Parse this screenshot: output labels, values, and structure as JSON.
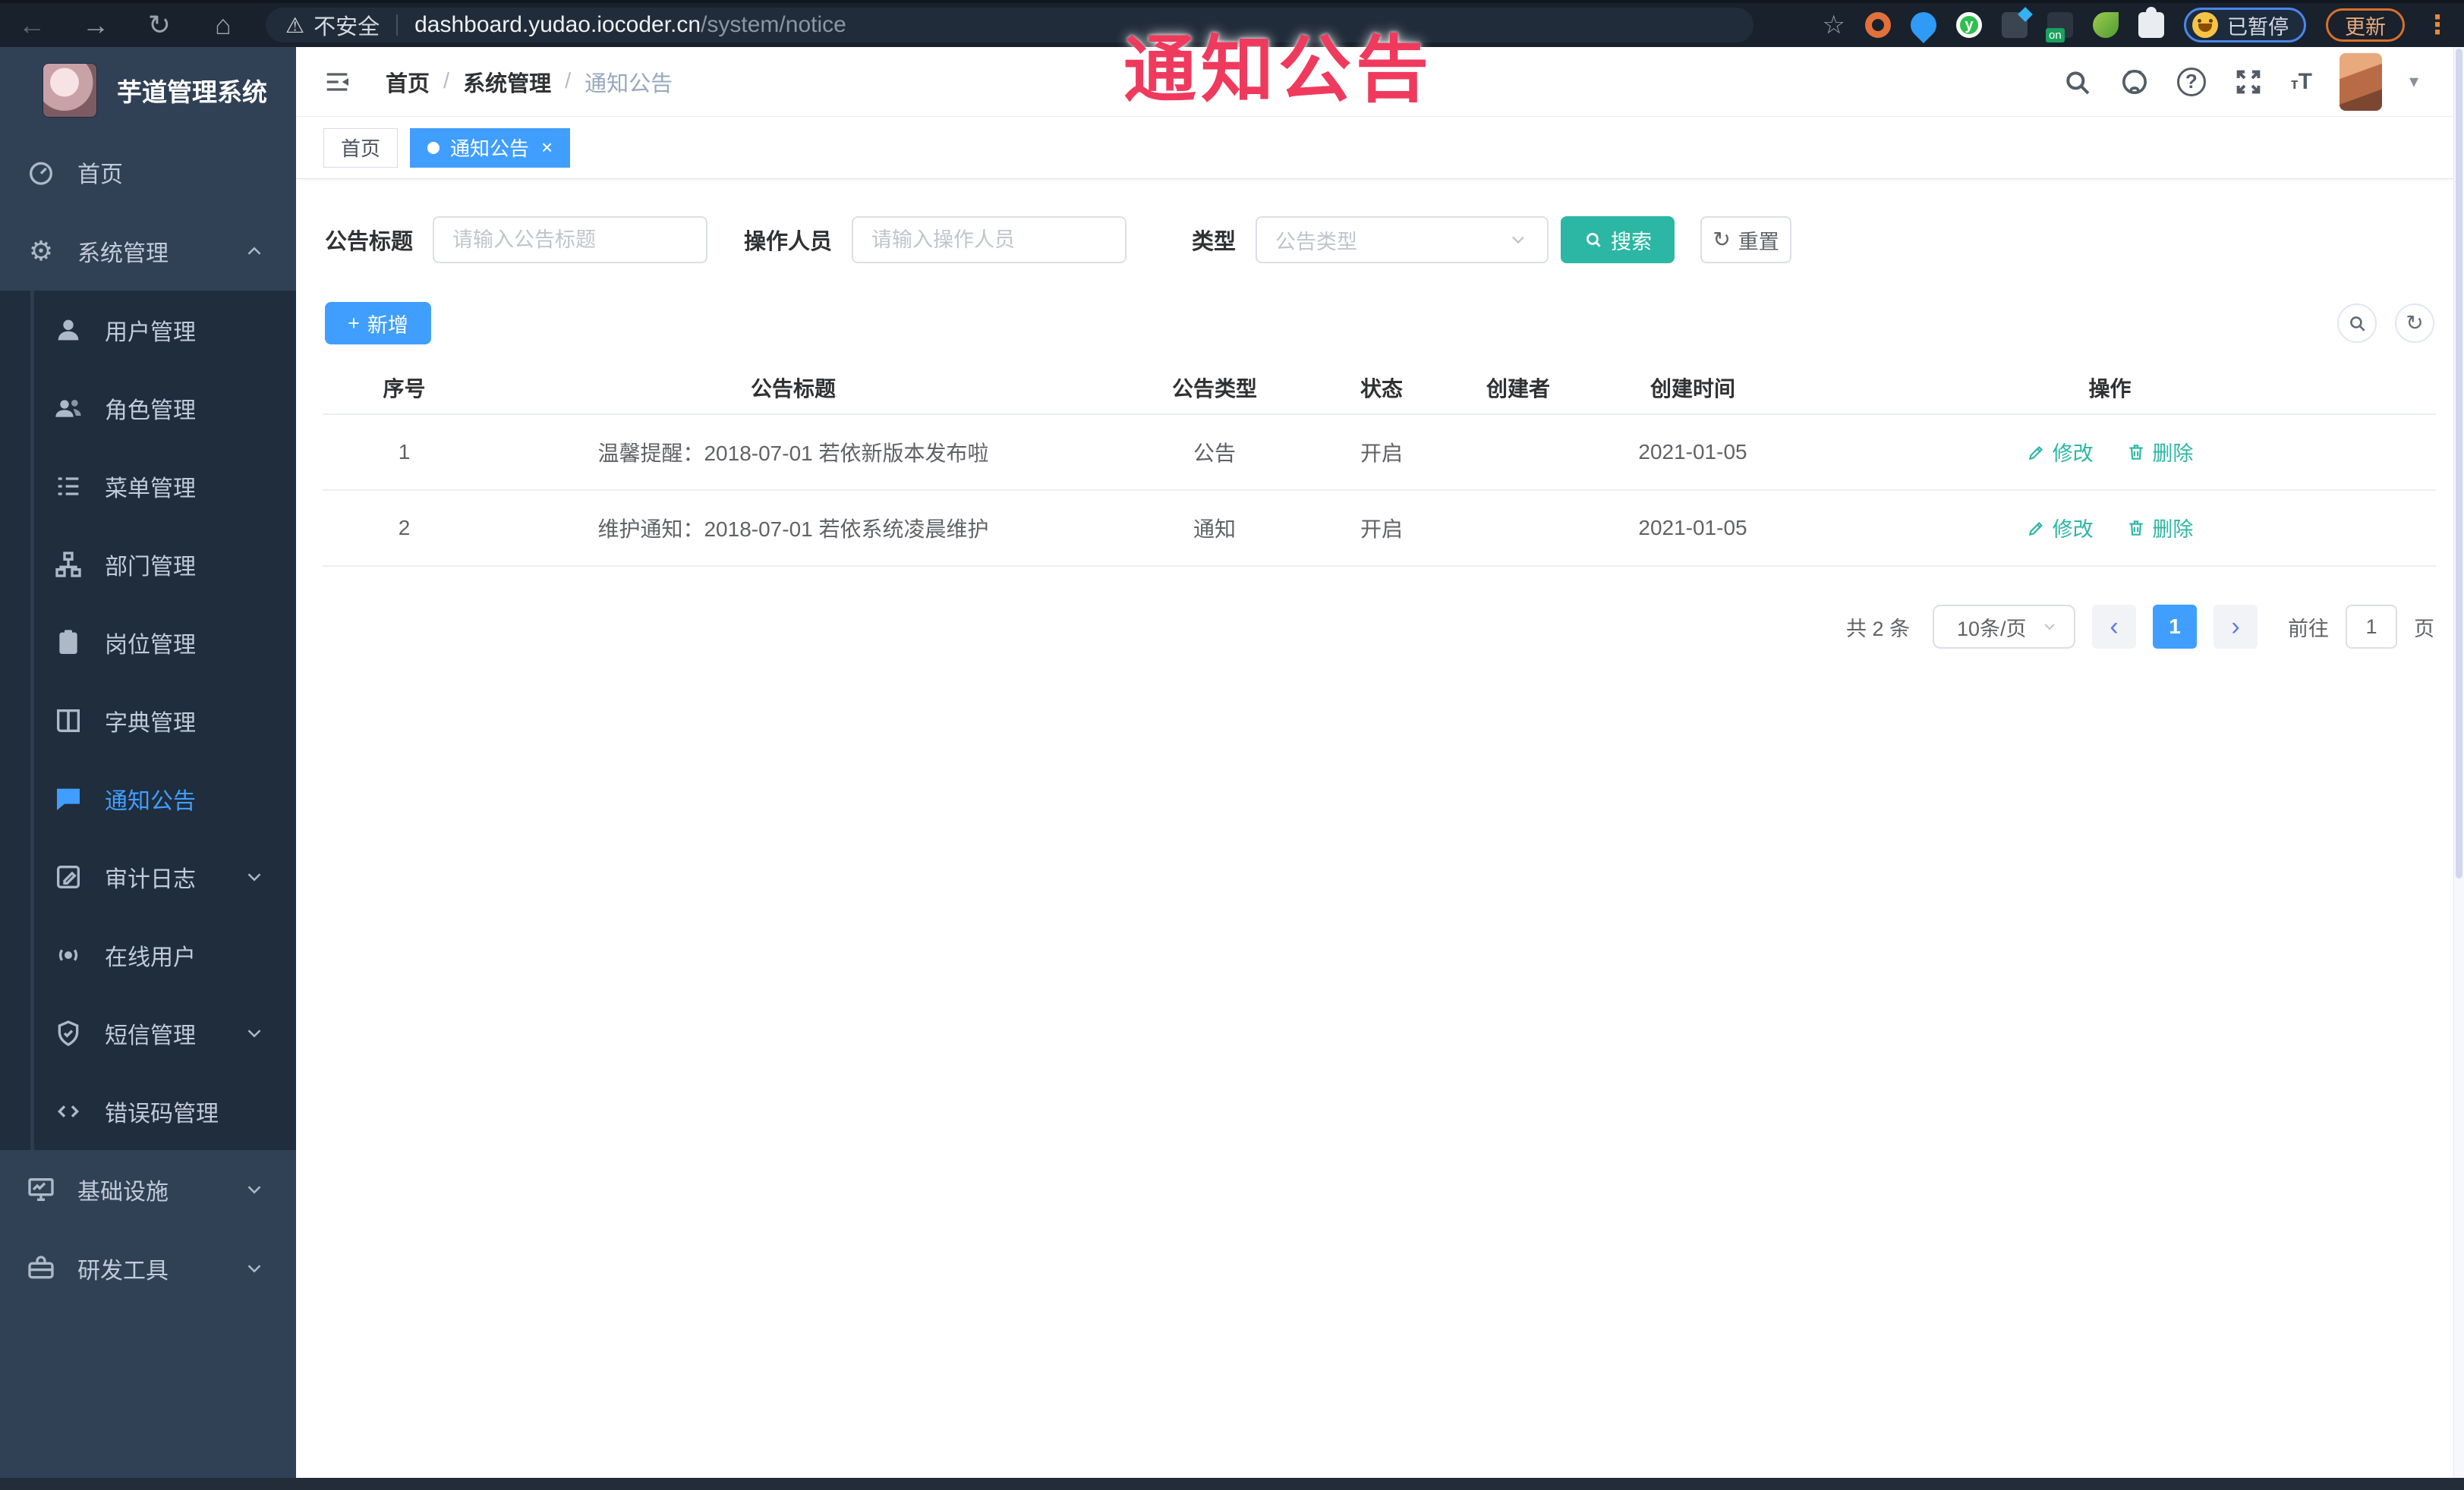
{
  "browser": {
    "security_label": "不安全",
    "url_host": "dashboard.yudao.iocoder.cn",
    "url_path": "/system/notice",
    "profile_status": "已暂停",
    "update_label": "更新"
  },
  "icons": {
    "back": "←",
    "forward": "→",
    "reload": "↻",
    "home": "⌂",
    "star": "☆",
    "warning": "⚠",
    "gear": "⚙",
    "plus": "+",
    "close": "×",
    "prev": "‹",
    "next": "›",
    "question": "?",
    "refresh": "↻",
    "caret_down": "▾",
    "kebab": "⋮",
    "font_small": "т",
    "font_large": "T"
  },
  "overlay": {
    "title": "通知公告"
  },
  "sidebar": {
    "logo_title": "芋道管理系统",
    "items": [
      {
        "label": "首页"
      },
      {
        "label": "系统管理",
        "expanded": true,
        "children": [
          "用户管理",
          "角色管理",
          "菜单管理",
          "部门管理",
          "岗位管理",
          "字典管理",
          "通知公告",
          "审计日志",
          "在线用户",
          "短信管理",
          "错误码管理"
        ]
      },
      {
        "label": "基础设施"
      },
      {
        "label": "研发工具"
      }
    ],
    "active_item": "通知公告"
  },
  "breadcrumb": {
    "items": [
      "首页",
      "系统管理",
      "通知公告"
    ],
    "separator": "/"
  },
  "tabs": [
    {
      "label": "首页",
      "active": false
    },
    {
      "label": "通知公告",
      "active": true
    }
  ],
  "filters": {
    "title_label": "公告标题",
    "title_placeholder": "请输入公告标题",
    "operator_label": "操作人员",
    "operator_placeholder": "请输入操作人员",
    "type_label": "类型",
    "type_placeholder": "公告类型",
    "search_label": "搜索",
    "reset_label": "重置"
  },
  "toolbar": {
    "add_label": "新增"
  },
  "table": {
    "columns": [
      "序号",
      "公告标题",
      "公告类型",
      "状态",
      "创建者",
      "创建时间",
      "操作"
    ],
    "rows": [
      {
        "no": "1",
        "title": "温馨提醒：2018-07-01 若依新版本发布啦",
        "type": "公告",
        "status": "开启",
        "creator": "",
        "created": "2021-01-05"
      },
      {
        "no": "2",
        "title": "维护通知：2018-07-01 若依系统凌晨维护",
        "type": "通知",
        "status": "开启",
        "creator": "",
        "created": "2021-01-05"
      }
    ],
    "edit_label": "修改",
    "delete_label": "删除"
  },
  "pagination": {
    "total": "共 2 条",
    "page_size": "10条/页",
    "current": "1",
    "goto_label": "前往",
    "goto_value": "1",
    "unit_label": "页"
  },
  "colors": {
    "primary": "#409eff",
    "teal": "#2bb7a3",
    "overlay_red": "#ef3a5e",
    "sidebar_bg": "#304156",
    "submenu_bg": "#1f2d3d"
  }
}
